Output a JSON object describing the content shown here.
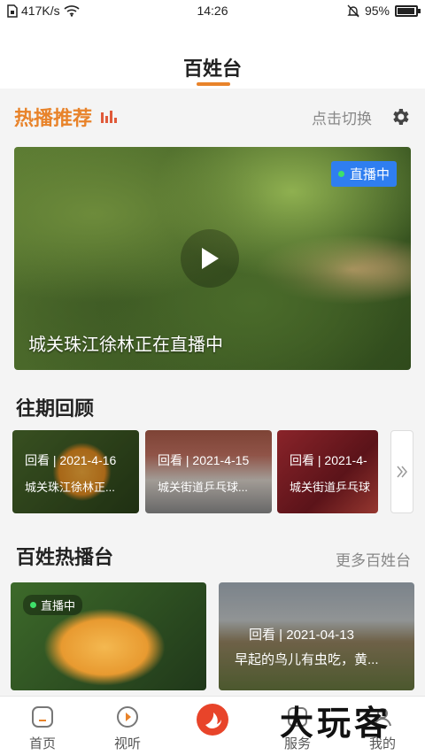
{
  "status_bar": {
    "net_speed": "417K/s",
    "time": "14:26",
    "battery": "95%",
    "battery_level": 0.95
  },
  "header": {
    "title": "百姓台"
  },
  "hot": {
    "title": "热播推荐",
    "switch_label": "点击切换",
    "live_badge": "直播中",
    "caption": "城关珠江徐林正在直播中"
  },
  "past": {
    "title": "往期回顾",
    "items": [
      {
        "date": "回看 | 2021-4-16",
        "name": "城关珠江徐林正..."
      },
      {
        "date": "回看 | 2021-4-15",
        "name": "城关街道乒乓球..."
      },
      {
        "date": "回看 | 2021-4-",
        "name": "城关街道乒乓球"
      }
    ]
  },
  "people": {
    "title": "百姓热播台",
    "more_label": "更多百姓台",
    "cards": [
      {
        "live_tag": "直播中"
      },
      {
        "date": "回看  |  2021-04-13",
        "name": "早起的鸟儿有虫吃，黄..."
      }
    ]
  },
  "tabs": [
    {
      "label": "首页",
      "icon": "home-icon"
    },
    {
      "label": "视听",
      "icon": "play-circle-icon"
    },
    {
      "label": "",
      "icon": "phoenix-logo-icon"
    },
    {
      "label": "服务",
      "icon": "service-icon"
    },
    {
      "label": "我的",
      "icon": "profile-icon"
    }
  ],
  "watermark": "大玩客",
  "colors": {
    "accent": "#e8832a",
    "live_blue": "#2f7ef0",
    "live_green": "#3ee06a"
  }
}
